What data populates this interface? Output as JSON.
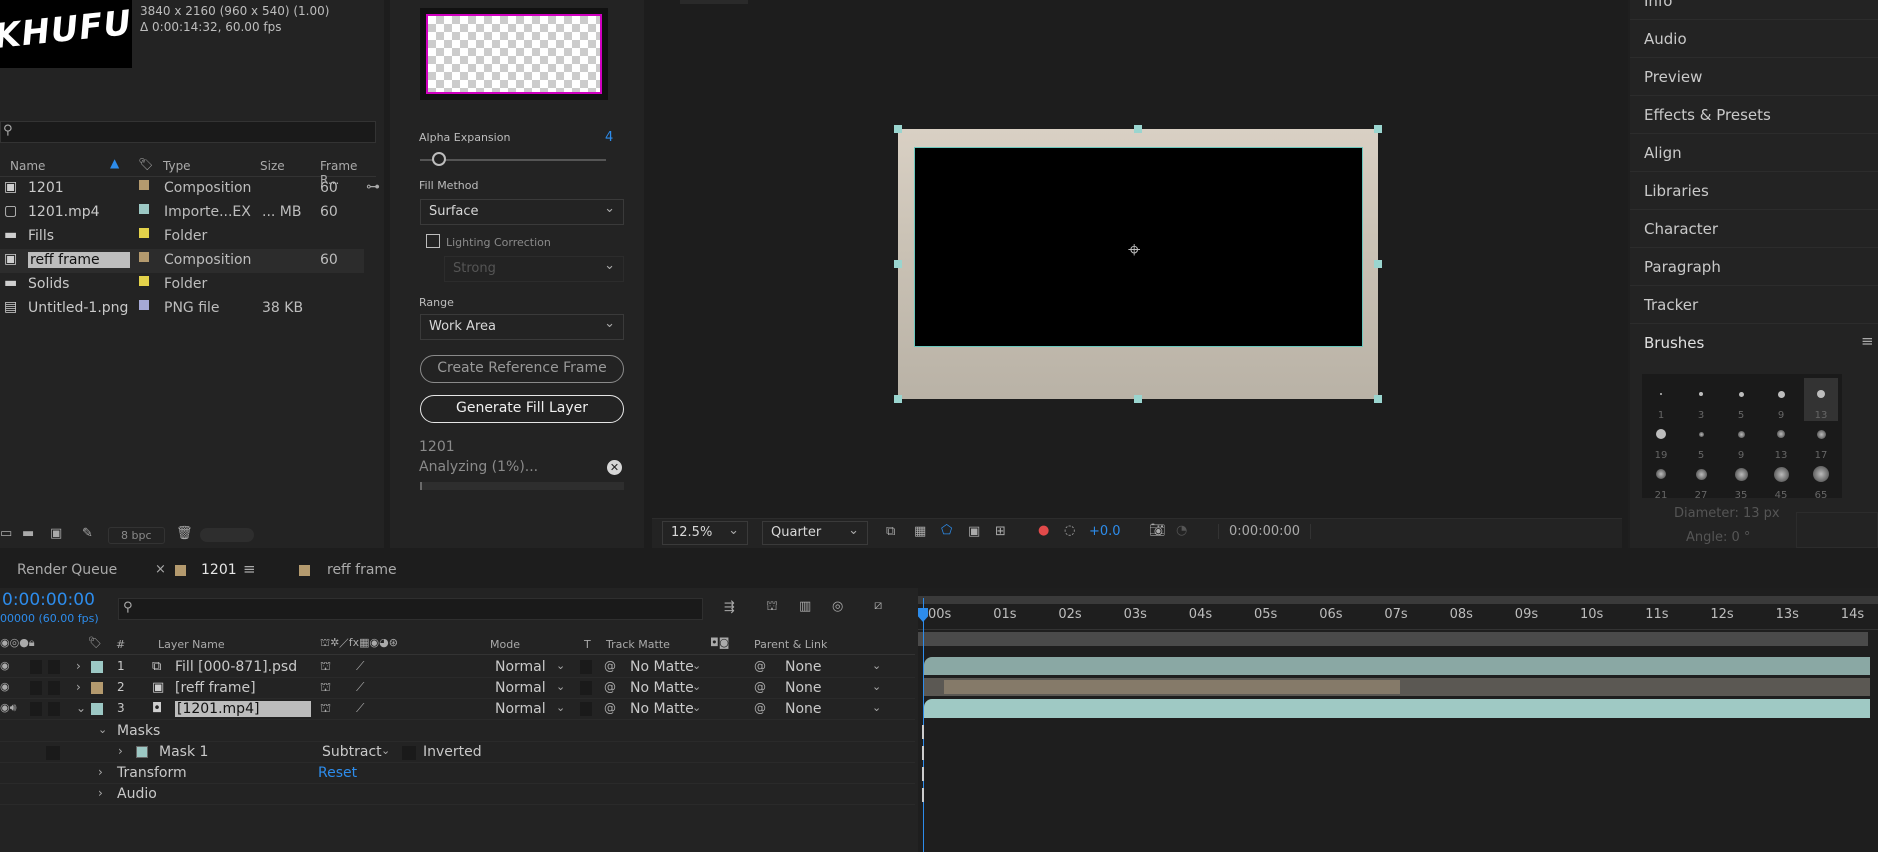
{
  "project": {
    "logo_text": "KHUFU",
    "meta_line1": "3840 x 2160  (960 x 540) (1.00)",
    "meta_line2": "Δ 0:00:14:32, 60.00 fps",
    "columns": [
      "Name",
      "Type",
      "Size",
      "Frame R..."
    ],
    "items": [
      {
        "name": "1201",
        "type": "Composition",
        "size": "",
        "fps": "60",
        "color": "#b49a6e",
        "icon": "composition-icon"
      },
      {
        "name": "1201.mp4",
        "type": "Importe...EX",
        "size": "... MB",
        "fps": "60",
        "color": "#9cc8c4",
        "icon": "video-file-icon"
      },
      {
        "name": "Fills",
        "type": "Folder",
        "size": "",
        "fps": "",
        "color": "#e3d24a",
        "icon": "folder-icon"
      },
      {
        "name": "reff frame",
        "type": "Composition",
        "size": "",
        "fps": "60",
        "color": "#b49a6e",
        "icon": "composition-icon"
      },
      {
        "name": "Solids",
        "type": "Folder",
        "size": "",
        "fps": "",
        "color": "#e3d24a",
        "icon": "folder-icon"
      },
      {
        "name": "Untitled-1.png",
        "type": "PNG file",
        "size": "38 KB",
        "fps": "",
        "color": "#a5a9d6",
        "icon": "image-file-icon"
      }
    ],
    "bpc": "8 bpc"
  },
  "content_fill": {
    "alpha_expansion_label": "Alpha Expansion",
    "alpha_expansion_value": "4",
    "fill_method_label": "Fill Method",
    "fill_method_value": "Surface",
    "lighting_correction_label": "Lighting Correction",
    "lighting_strength": "Strong",
    "range_label": "Range",
    "range_value": "Work Area",
    "create_ref_label": "Create Reference Frame",
    "generate_label": "Generate Fill Layer",
    "status_comp": "1201",
    "status_text": "Analyzing (1%)...",
    "progress": 0.01
  },
  "viewer": {
    "zoom": "12.5%",
    "resolution": "Quarter",
    "exposure": "+0.0",
    "timecode": "0:00:00:00"
  },
  "right_panel": {
    "items": [
      "Info",
      "Audio",
      "Preview",
      "Effects & Presets",
      "Align",
      "Libraries",
      "Character",
      "Paragraph",
      "Tracker"
    ],
    "brushes_title": "Brushes",
    "brush_sizes": [
      "1",
      "3",
      "5",
      "9",
      "13",
      "19",
      "5",
      "9",
      "13",
      "17",
      "21",
      "27",
      "35",
      "45",
      "65"
    ],
    "diameter": "Diameter: 13 px",
    "angle": "Angle: 0 °"
  },
  "tabs": {
    "render_queue": "Render Queue",
    "comp1": "1201",
    "comp2": "reff frame",
    "comp1_color": "#b49a6e",
    "comp2_color": "#b49a6e"
  },
  "timeline": {
    "timecode": "0:00:00:00",
    "fps_sub": "00000 (60.00 fps)",
    "headers": {
      "num": "#",
      "layer_name": "Layer Name",
      "mode": "Mode",
      "t": "T",
      "track_matte": "Track Matte",
      "parent": "Parent & Link"
    },
    "layers": [
      {
        "num": "1",
        "name": "Fill  [000-871].psd",
        "mode": "Normal",
        "matte": "No Matte",
        "parent": "None",
        "color": "#9cc8c4"
      },
      {
        "num": "2",
        "name": "[reff frame]",
        "mode": "Normal",
        "matte": "No Matte",
        "parent": "None",
        "color": "#b49a6e"
      },
      {
        "num": "3",
        "name": "[1201.mp4]",
        "mode": "Normal",
        "matte": "No Matte",
        "parent": "None",
        "color": "#9cc8c4"
      }
    ],
    "masks_label": "Masks",
    "mask1_label": "Mask 1",
    "mask_mode": "Subtract",
    "inverted_label": "Inverted",
    "transform_label": "Transform",
    "reset_label": "Reset",
    "audio_label": "Audio",
    "ruler": [
      "00s",
      "01s",
      "02s",
      "03s",
      "04s",
      "05s",
      "06s",
      "07s",
      "08s",
      "09s",
      "10s",
      "11s",
      "12s",
      "13s",
      "14s"
    ]
  }
}
